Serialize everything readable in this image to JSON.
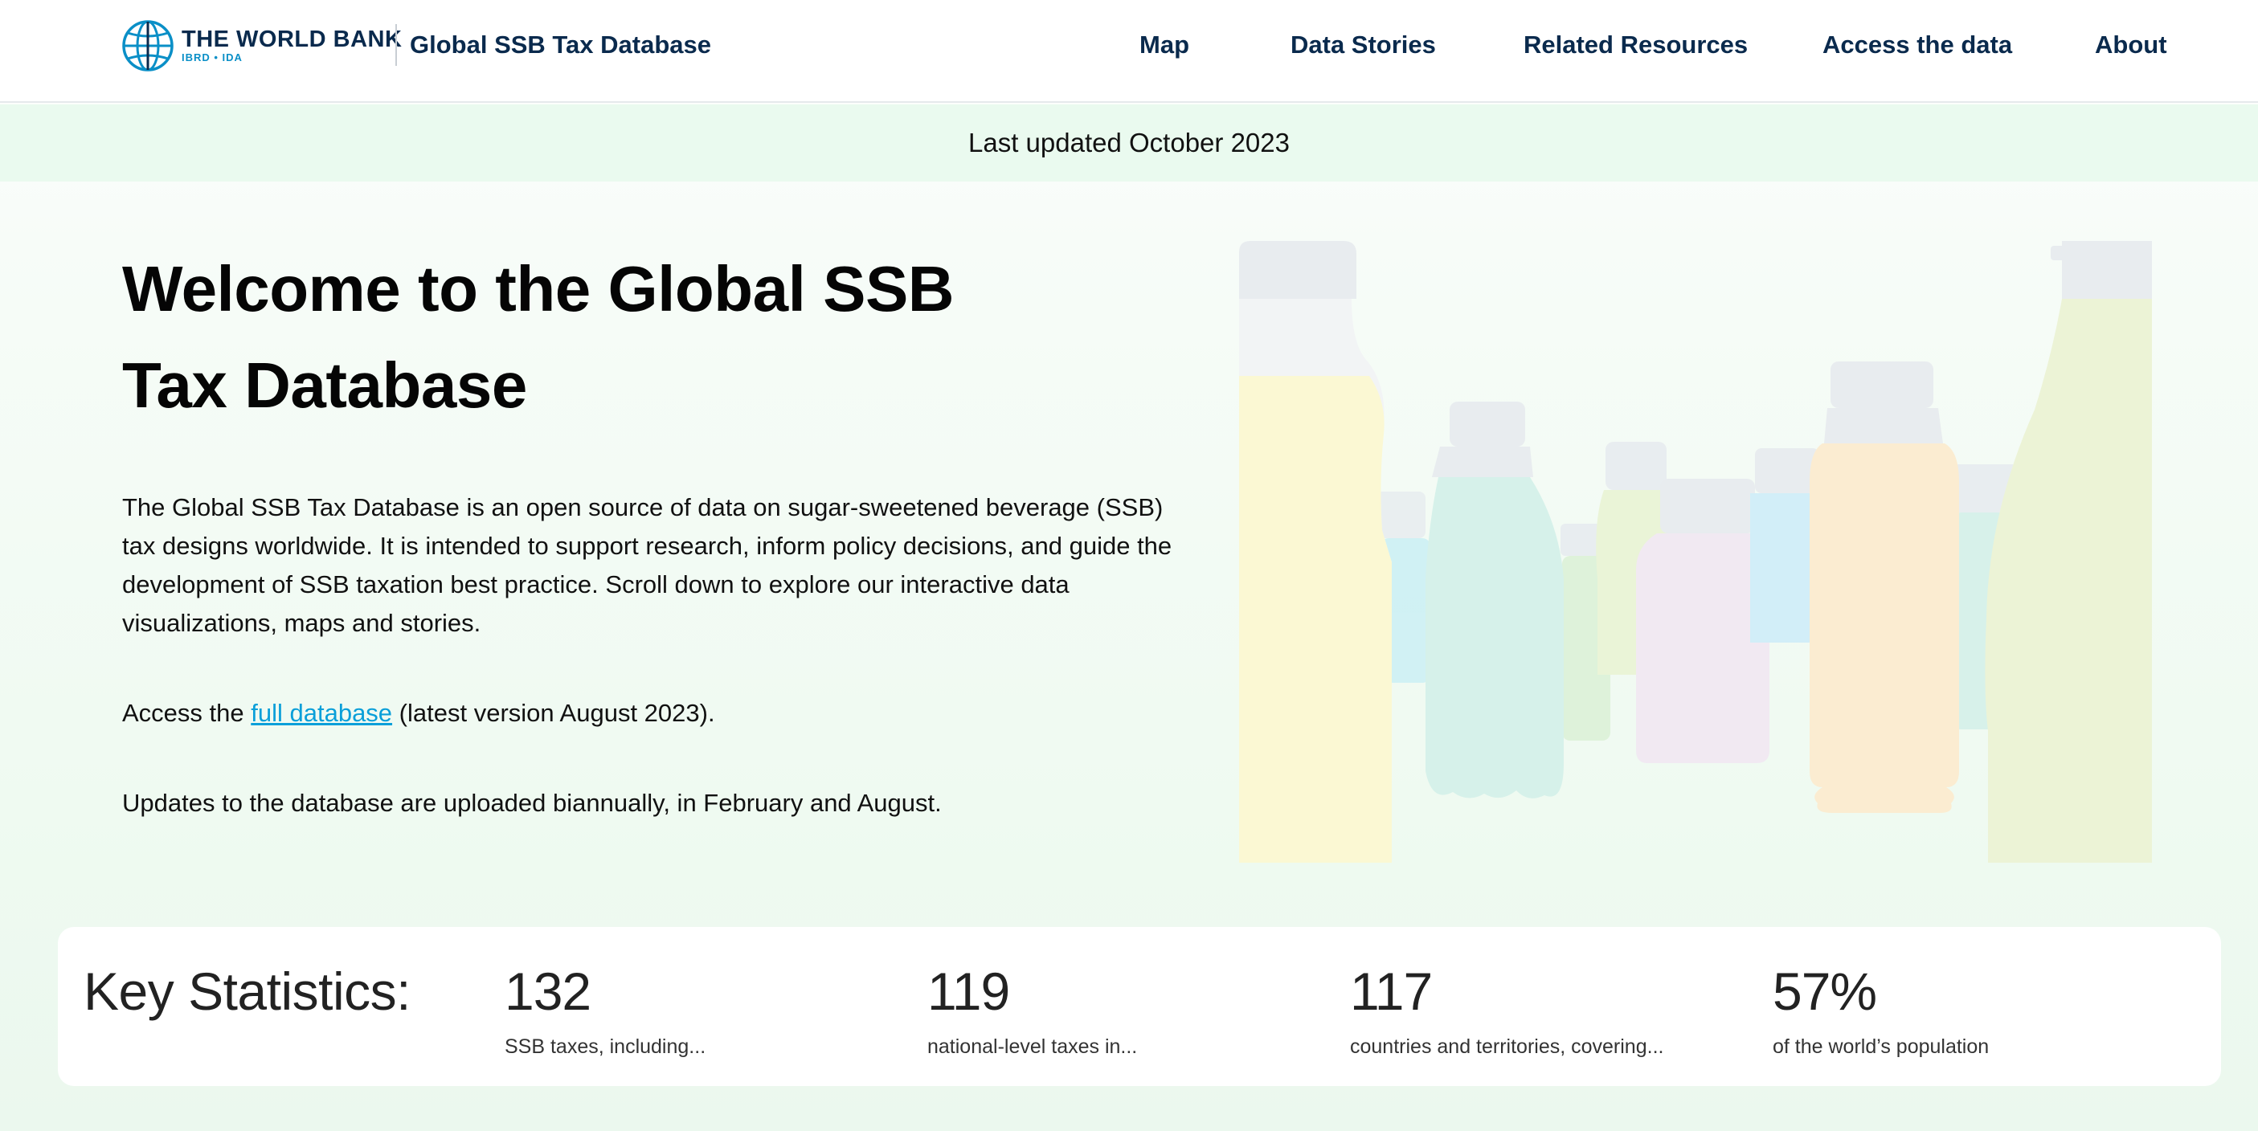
{
  "header": {
    "logo_text": "THE WORLD BANK",
    "logo_subtext": "IBRD • IDA",
    "site_title": "Global SSB Tax Database",
    "nav": [
      "Map",
      "Data Stories",
      "Related Resources",
      "Access the data",
      "About"
    ]
  },
  "banner": {
    "text": "Last updated October 2023"
  },
  "hero": {
    "title": "Welcome to the Global SSB Tax Database",
    "intro": "The Global SSB Tax Database is an open source of data on sugar-sweetened beverage (SSB) tax designs worldwide. It is intended to support research, inform policy decisions, and guide the development of SSB taxation best practice. Scroll down to explore our interactive data visualizations, maps and stories.",
    "access_prefix": "Access the ",
    "access_link": "full database",
    "access_suffix": " (latest version August 2023).",
    "updates": "Updates to the database are uploaded biannually, in February and August."
  },
  "stats": {
    "label": "Key Statistics:",
    "items": [
      {
        "value": "132",
        "desc": "SSB taxes, including..."
      },
      {
        "value": "119",
        "desc": "national-level taxes in..."
      },
      {
        "value": "117",
        "desc": "countries and territories, covering..."
      },
      {
        "value": "57%",
        "desc": "of the world’s population"
      }
    ]
  },
  "colors": {
    "navy": "#0a2a4d",
    "link": "#0a9fd9",
    "banner_bg": "#eafaef"
  }
}
